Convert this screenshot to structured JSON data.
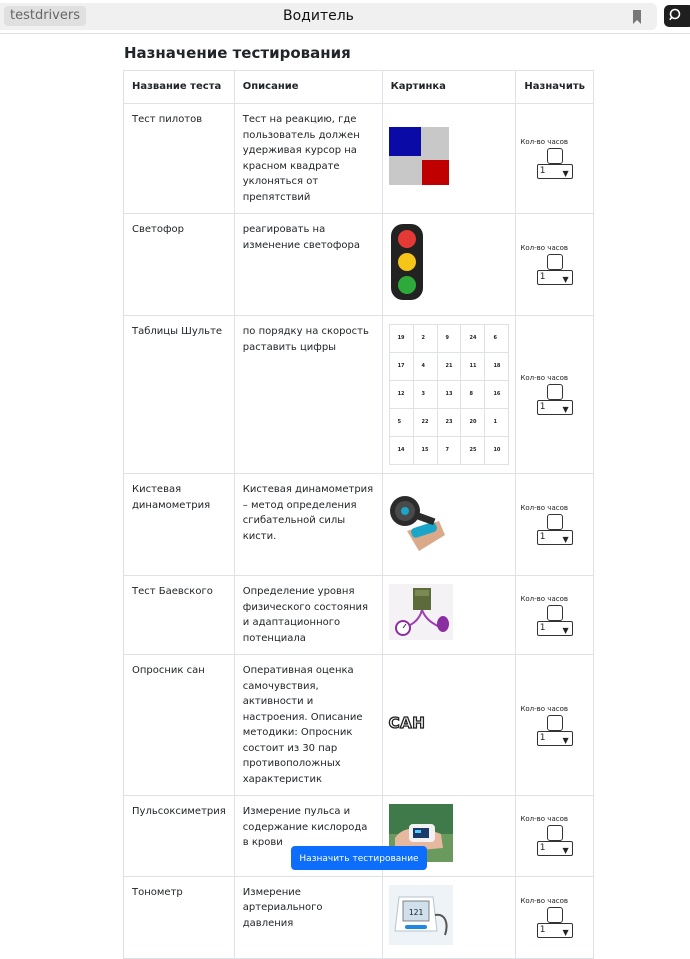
{
  "topbar": {
    "brand": "testdrivers",
    "title": "Водитель"
  },
  "page": {
    "title": "Назначение тестирования"
  },
  "table": {
    "headers": [
      "Название теста",
      "Описание",
      "Картинка",
      "Назначить"
    ],
    "hours_label": "Кол-во часов",
    "rows": [
      {
        "name": "Тест пилотов",
        "desc": "Тест на реакцию, где пользователь должен удерживая курсор на красном квадрате уклоняться от препятствий",
        "hours": "1",
        "icon": "pilot-test-image"
      },
      {
        "name": "Светофор",
        "desc": "реагировать на изменение светофора",
        "hours": "1",
        "icon": "traffic-light-image"
      },
      {
        "name": "Таблицы Шульте",
        "desc": "по порядку на скорость раставить цифры",
        "hours": "1",
        "icon": "schulte-table-image"
      },
      {
        "name": "Кистевая динамометрия",
        "desc": "Кистевая динамометрия – метод определения сгибательной силы кисти.",
        "hours": "1",
        "icon": "dynamometer-image"
      },
      {
        "name": "Тест Баевского",
        "desc": "Определение уровня физического состояния и адаптационного потенциала",
        "hours": "1",
        "icon": "sphygmomanometer-image"
      },
      {
        "name": "Опросник сан",
        "desc": "Оперативная оценка самочувствия, активности и настроения. Описание методики: Опросник состоит из 30 пар противоположных характеристик",
        "hours": "1",
        "icon": "san-text-image"
      },
      {
        "name": "Пульсоксиметрия",
        "desc": "Измерение пульса и содержание кислорода в крови",
        "hours": "1",
        "icon": "pulse-oximeter-image"
      },
      {
        "name": "Тонометр",
        "desc": "Измерение артериального давления",
        "hours": "1",
        "icon": "tonometer-image"
      }
    ]
  },
  "schulte_numbers": [
    "19",
    "2",
    "9",
    "24",
    "6",
    "17",
    "4",
    "21",
    "11",
    "18",
    "12",
    "3",
    "13",
    "8",
    "16",
    "5",
    "22",
    "23",
    "20",
    "1",
    "14",
    "15",
    "7",
    "25",
    "10"
  ],
  "san_text": "САН",
  "tonometer_reading": "121",
  "submit_label": "Назначить тестирование",
  "colors": {
    "primary": "#0d6efd",
    "pilot_blue": "#0a0aa6",
    "pilot_red": "#c00000"
  }
}
